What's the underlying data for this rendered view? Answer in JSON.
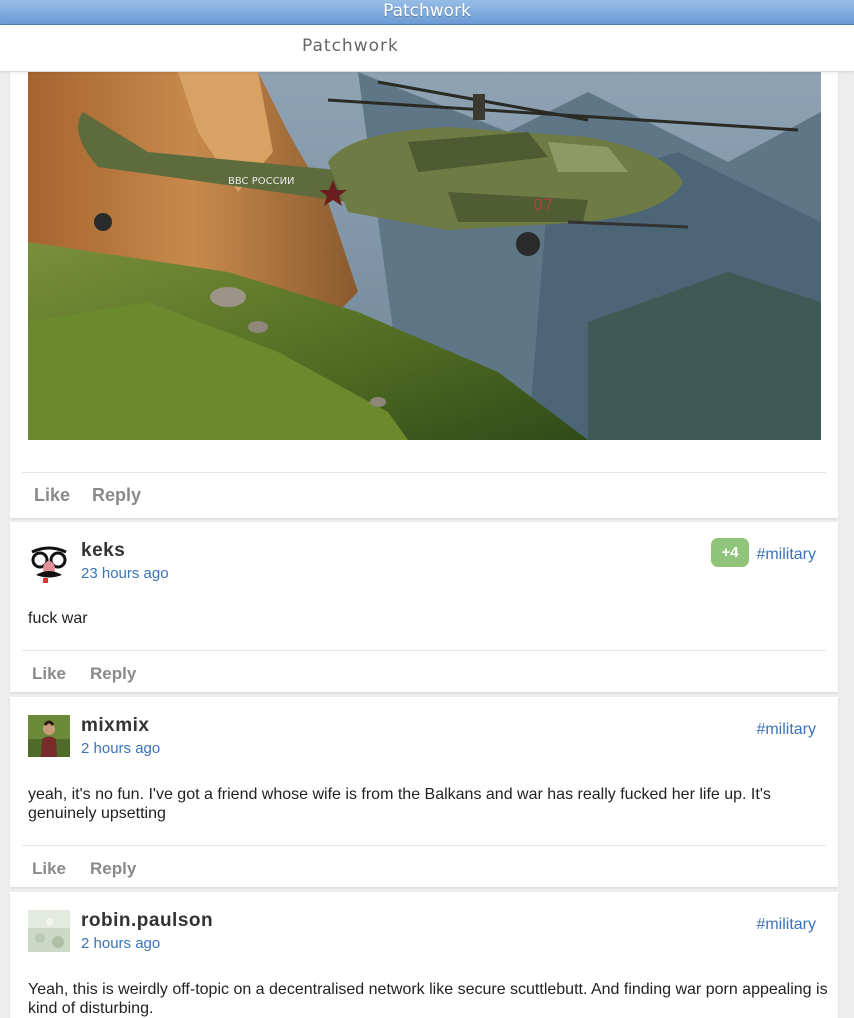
{
  "window": {
    "title": "Patchwork"
  },
  "header": {
    "app_title": "Patchwork"
  },
  "colors": {
    "link": "#3b73b9",
    "vote_badge": "#8fc47a",
    "titlebar": "#6b9bd4"
  },
  "top_post": {
    "image_alt": "Military helicopter over mountain valley",
    "actions": {
      "like": "Like",
      "reply": "Reply"
    }
  },
  "posts": [
    {
      "author": "keks",
      "time": "23 hours ago",
      "channel": "#military",
      "votes": "+4",
      "text": "fuck war",
      "actions": {
        "like": "Like",
        "reply": "Reply"
      }
    },
    {
      "author": "mixmix",
      "time": "2 hours ago",
      "channel": "#military",
      "text": "yeah, it's no fun. I've got a friend whose wife is from the Balkans and war has really fucked her life up. It's genuinely upsetting",
      "actions": {
        "like": "Like",
        "reply": "Reply"
      }
    },
    {
      "author": "robin.paulson",
      "time": "2 hours ago",
      "channel": "#military",
      "text": "Yeah, this is weirdly off-topic on a decentralised network like secure scuttlebutt. And finding war porn appealing is kind of disturbing."
    }
  ]
}
